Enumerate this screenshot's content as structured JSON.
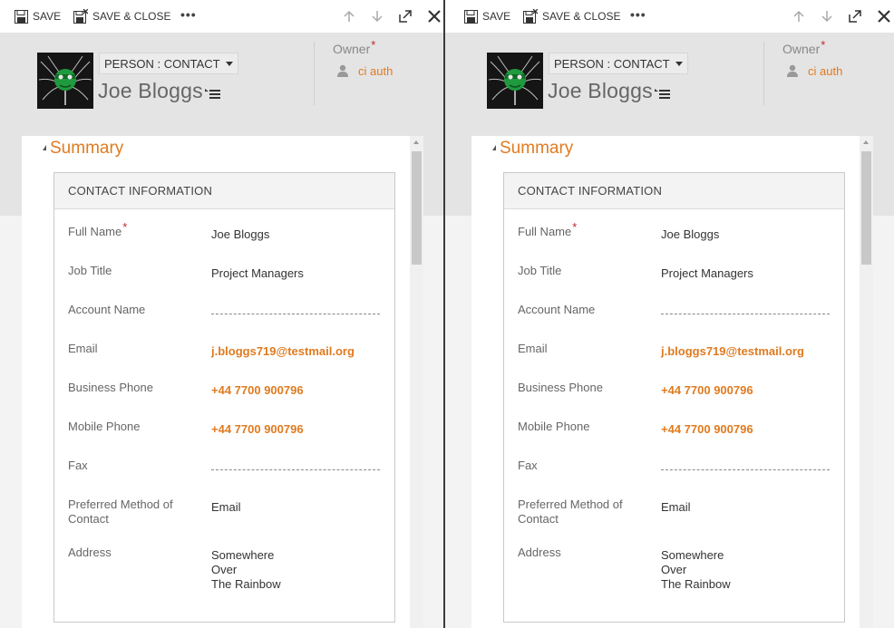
{
  "command_bar": {
    "save_label": "SAVE",
    "save_close_label": "SAVE & CLOSE",
    "more_label": "•••"
  },
  "record": {
    "entity_selector": "PERSON : CONTACT",
    "name": "Joe Bloggs",
    "owner_label": "Owner",
    "owner_required_mark": "*",
    "owner_value": "ci auth"
  },
  "summary": {
    "title": "Summary"
  },
  "section": {
    "title": "CONTACT INFORMATION",
    "fields": [
      {
        "label": "Full Name",
        "required_mark": "*",
        "value": "Joe Bloggs"
      },
      {
        "label": "Job Title",
        "value": "Project Managers"
      },
      {
        "label": "Account Name",
        "value": ""
      },
      {
        "label": "Email",
        "value": "j.bloggs719@testmail.org"
      },
      {
        "label": "Business Phone",
        "value": "+44 7700 900796"
      },
      {
        "label": "Mobile Phone",
        "value": "+44 7700 900796"
      },
      {
        "label": "Fax",
        "value": ""
      },
      {
        "label": "Preferred Method of Contact",
        "value": "Email"
      },
      {
        "label": "Address",
        "value_lines": [
          "Somewhere",
          "Over",
          "The Rainbow"
        ]
      }
    ]
  },
  "colors": {
    "accent": "#e07b20",
    "required": "#c1272d",
    "header_bg": "#e4e4e4"
  },
  "icons": {
    "save": "floppy-disk-icon",
    "save_close": "floppy-disk-close-icon",
    "up": "arrow-up-icon",
    "down": "arrow-down-icon",
    "popout": "popout-icon",
    "close": "close-icon",
    "owner": "person-icon",
    "record_menu": "record-menu-icon"
  }
}
